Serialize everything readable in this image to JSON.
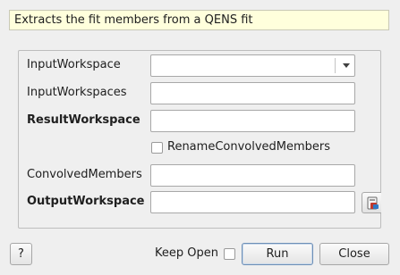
{
  "description": "Extracts the fit members from a QENS fit",
  "properties": {
    "input_workspace": {
      "label": "InputWorkspace",
      "value": ""
    },
    "input_workspaces": {
      "label": "InputWorkspaces",
      "value": ""
    },
    "result_workspace": {
      "label": "ResultWorkspace",
      "value": ""
    },
    "rename_convolved_members": {
      "label": "RenameConvolvedMembers",
      "checked": false
    },
    "convolved_members": {
      "label": "ConvolvedMembers",
      "value": ""
    },
    "output_workspace": {
      "label": "OutputWorkspace",
      "value": ""
    }
  },
  "footer": {
    "help_label": "?",
    "keep_open_label": "Keep Open",
    "keep_open_checked": false,
    "run_label": "Run",
    "close_label": "Close"
  },
  "icons": {
    "output_browse": "workspace-picker-icon",
    "combo_arrow": "chevron-down-icon"
  }
}
